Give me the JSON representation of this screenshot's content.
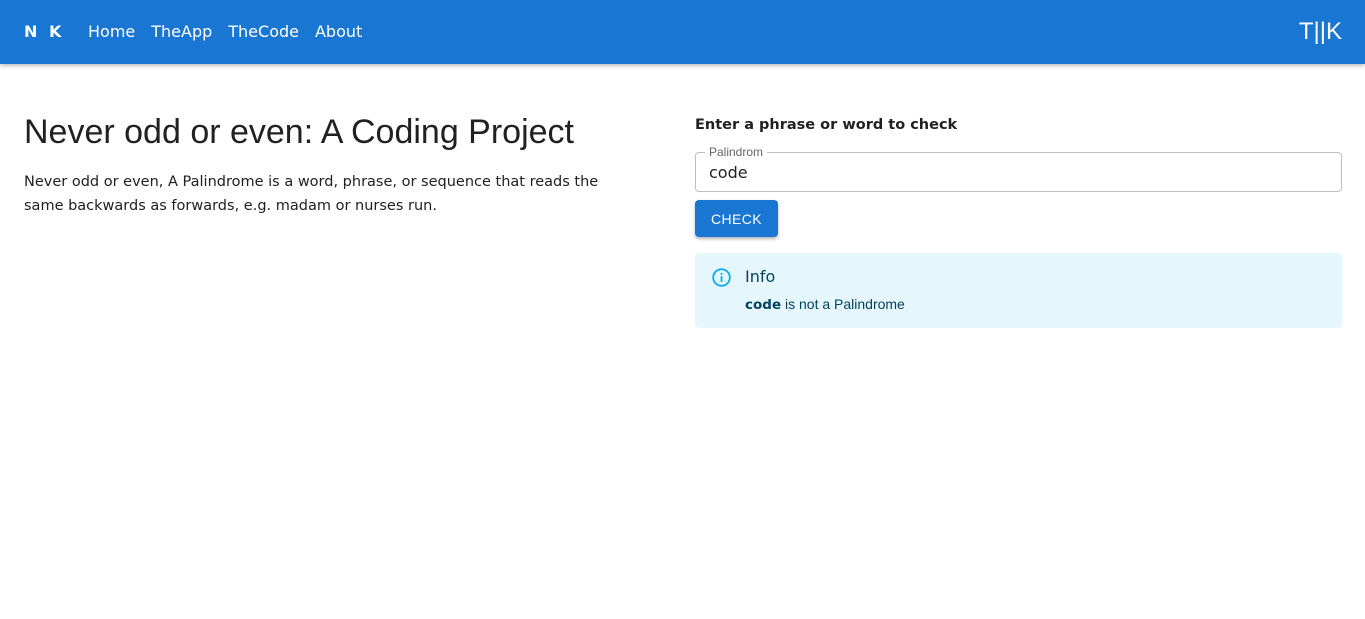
{
  "header": {
    "brand": "N K",
    "nav": [
      {
        "label": "Home"
      },
      {
        "label": "TheApp"
      },
      {
        "label": "TheCode"
      },
      {
        "label": "About"
      }
    ],
    "right_brand": "T||K"
  },
  "main": {
    "title": "Never odd or even: A Coding Project",
    "description": "Never odd or even, A Palindrome is a word, phrase, or sequence that reads the same backwards as forwards, e.g. madam or nurses run."
  },
  "form": {
    "heading": "Enter a phrase or word to check",
    "field_label": "Palindrom",
    "field_value": "code",
    "button_label": "Check"
  },
  "alert": {
    "icon": "info-icon",
    "title": "Info",
    "word": "code",
    "message": " is not a Palindrome"
  },
  "colors": {
    "primary": "#1976d2",
    "alert_bg": "#e5f6fd",
    "alert_icon": "#03a9f4",
    "alert_text": "#014361"
  }
}
